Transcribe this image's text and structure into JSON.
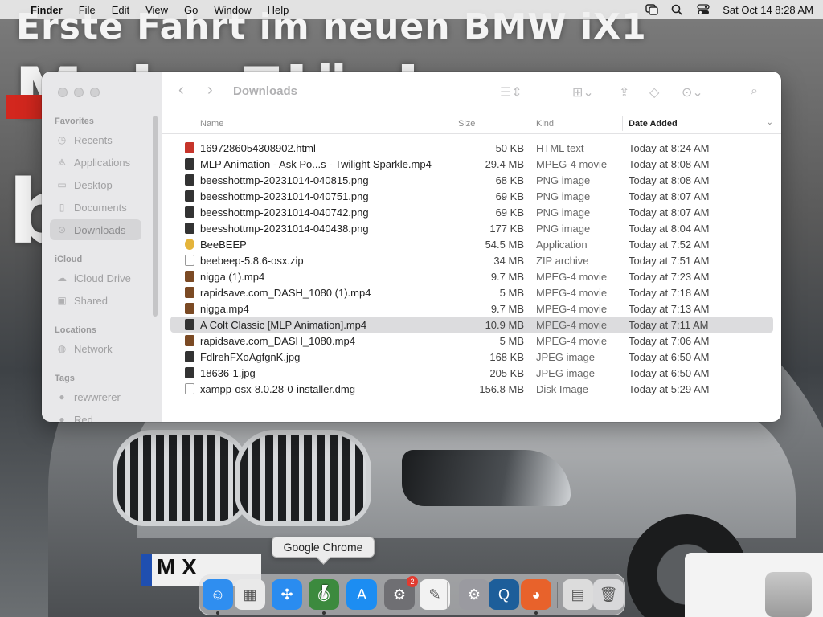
{
  "wallpaper": {
    "headline_top": "Erste Fahrt im neuen BMW iX1",
    "plate_text": "M X"
  },
  "menubar": {
    "app_name": "Finder",
    "menus": [
      "File",
      "Edit",
      "View",
      "Go",
      "Window",
      "Help"
    ],
    "icons": [
      "apple-icon",
      "screen-mirroring-icon",
      "spotlight-icon",
      "control-center-icon"
    ],
    "clock": "Sat Oct 14  8:28 AM"
  },
  "finder": {
    "title": "Downloads",
    "sidebar": {
      "favorites_heading": "Favorites",
      "favorites": [
        {
          "label": "Recents",
          "icon": "clock-icon"
        },
        {
          "label": "Applications",
          "icon": "applications-icon"
        },
        {
          "label": "Desktop",
          "icon": "desktop-icon"
        },
        {
          "label": "Documents",
          "icon": "document-icon"
        },
        {
          "label": "Downloads",
          "icon": "download-icon"
        }
      ],
      "icloud_heading": "iCloud",
      "icloud": [
        {
          "label": "iCloud Drive",
          "icon": "cloud-icon"
        },
        {
          "label": "Shared",
          "icon": "shared-folder-icon"
        }
      ],
      "locations_heading": "Locations",
      "locations": [
        {
          "label": "Network",
          "icon": "globe-icon"
        }
      ],
      "tags_heading": "Tags",
      "tags": [
        {
          "label": "rewwrerer",
          "color": "#b5b5b7"
        },
        {
          "label": "Red",
          "color": "#b5b5b7"
        }
      ]
    },
    "columns": {
      "name": "Name",
      "size": "Size",
      "kind": "Kind",
      "date_added": "Date Added"
    },
    "files": [
      {
        "name": "1697286054308902.html",
        "size": "50 KB",
        "kind": "HTML text",
        "date": "Today at 8:24 AM",
        "icon": "html"
      },
      {
        "name": "MLP Animation - Ask Po...s - Twilight Sparkle.mp4",
        "size": "29.4 MB",
        "kind": "MPEG-4 movie",
        "date": "Today at 8:08 AM",
        "icon": "video"
      },
      {
        "name": "beesshottmp-20231014-040815.png",
        "size": "68 KB",
        "kind": "PNG image",
        "date": "Today at 8:08 AM",
        "icon": "image"
      },
      {
        "name": "beesshottmp-20231014-040751.png",
        "size": "69 KB",
        "kind": "PNG image",
        "date": "Today at 8:07 AM",
        "icon": "image"
      },
      {
        "name": "beesshottmp-20231014-040742.png",
        "size": "69 KB",
        "kind": "PNG image",
        "date": "Today at 8:07 AM",
        "icon": "image"
      },
      {
        "name": "beesshottmp-20231014-040438.png",
        "size": "177 KB",
        "kind": "PNG image",
        "date": "Today at 8:04 AM",
        "icon": "image"
      },
      {
        "name": "BeeBEEP",
        "size": "54.5 MB",
        "kind": "Application",
        "date": "Today at 7:52 AM",
        "icon": "app"
      },
      {
        "name": "beebeep-5.8.6-osx.zip",
        "size": "34 MB",
        "kind": "ZIP archive",
        "date": "Today at 7:51 AM",
        "icon": "doc"
      },
      {
        "name": "nigga (1).mp4",
        "size": "9.7 MB",
        "kind": "MPEG-4 movie",
        "date": "Today at 7:23 AM",
        "icon": "video2"
      },
      {
        "name": "rapidsave.com_DASH_1080 (1).mp4",
        "size": "5 MB",
        "kind": "MPEG-4 movie",
        "date": "Today at 7:18 AM",
        "icon": "video2"
      },
      {
        "name": "nigga.mp4",
        "size": "9.7 MB",
        "kind": "MPEG-4 movie",
        "date": "Today at 7:13 AM",
        "icon": "video2"
      },
      {
        "name": "A Colt Classic [MLP Animation].mp4",
        "size": "10.9 MB",
        "kind": "MPEG-4 movie",
        "date": "Today at 7:11 AM",
        "icon": "video",
        "selected": true
      },
      {
        "name": "rapidsave.com_DASH_1080.mp4",
        "size": "5 MB",
        "kind": "MPEG-4 movie",
        "date": "Today at 7:06 AM",
        "icon": "video2"
      },
      {
        "name": "FdlrehFXoAgfgnK.jpg",
        "size": "168 KB",
        "kind": "JPEG image",
        "date": "Today at 6:50 AM",
        "icon": "image"
      },
      {
        "name": "18636-1.jpg",
        "size": "205 KB",
        "kind": "JPEG image",
        "date": "Today at 6:50 AM",
        "icon": "image"
      },
      {
        "name": "xampp-osx-8.0.28-0-installer.dmg",
        "size": "156.8 MB",
        "kind": "Disk Image",
        "date": "Today at 5:29 AM",
        "icon": "doc"
      }
    ]
  },
  "dock": {
    "tooltip": "Google Chrome",
    "apps": [
      {
        "name": "finder",
        "icon": "finder-icon",
        "color": "#2f8ef0",
        "running": true
      },
      {
        "name": "launchpad",
        "icon": "launchpad-icon",
        "color": "#e9e9e9"
      },
      {
        "name": "safari",
        "icon": "safari-icon",
        "color": "#2a8cf0"
      },
      {
        "name": "chrome",
        "icon": "chrome-icon",
        "color": "#3c8a3e",
        "running": true
      },
      {
        "name": "app-store",
        "icon": "app-store-icon",
        "color": "#1c8df2"
      },
      {
        "name": "system-preferences",
        "icon": "system-settings-icon",
        "color": "#6f6f73",
        "badge": "2"
      },
      {
        "name": "textedit",
        "icon": "textedit-icon",
        "color": "#f2f2f2"
      },
      {
        "name": "settings-gear",
        "icon": "gear-icon",
        "color": "#9a9aa0"
      },
      {
        "name": "quicktime",
        "icon": "quicktime-icon",
        "color": "#1d5e9a"
      },
      {
        "name": "firefox",
        "icon": "firefox-icon",
        "color": "#e8622b",
        "running": true
      },
      {
        "name": "downloads-stack",
        "icon": "stack-icon",
        "color": "#dcdcdc"
      },
      {
        "name": "trash",
        "icon": "trash-icon",
        "color": "#d8d8da"
      }
    ]
  }
}
